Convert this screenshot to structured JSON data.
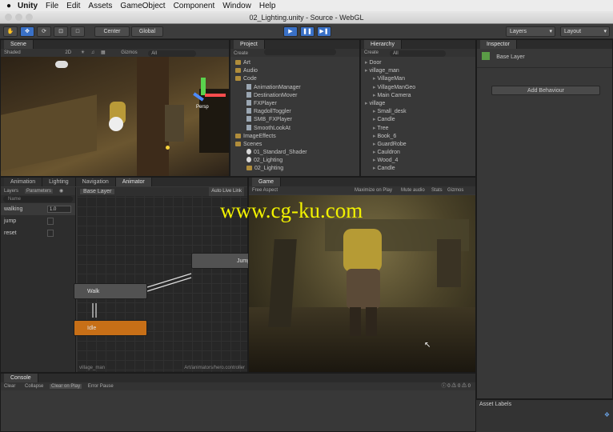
{
  "menu": {
    "app": "Unity",
    "items": [
      "File",
      "Edit",
      "Assets",
      "GameObject",
      "Component",
      "Window",
      "Help"
    ]
  },
  "window_title": "02_Lighting.unity - Source - WebGL",
  "toolbar": {
    "center": "Center",
    "global": "Global",
    "layers": "Layers",
    "layout": "Layout"
  },
  "scene": {
    "tab": "Scene",
    "shaded": "Shaded",
    "mode2d": "2D",
    "gizmos": "Gizmos",
    "search": "All",
    "persp": "Persp"
  },
  "project": {
    "tab": "Project",
    "create": "Create",
    "items": [
      {
        "label": "Art",
        "kind": "folder",
        "depth": 0
      },
      {
        "label": "Audio",
        "kind": "folder",
        "depth": 0
      },
      {
        "label": "Code",
        "kind": "folder",
        "depth": 0
      },
      {
        "label": "AnimationManager",
        "kind": "script",
        "depth": 1
      },
      {
        "label": "DestinationMover",
        "kind": "script",
        "depth": 1
      },
      {
        "label": "FXPlayer",
        "kind": "script",
        "depth": 1
      },
      {
        "label": "RagdollToggler",
        "kind": "script",
        "depth": 1
      },
      {
        "label": "SMB_FXPlayer",
        "kind": "script",
        "depth": 1
      },
      {
        "label": "SmoothLookAt",
        "kind": "script",
        "depth": 1
      },
      {
        "label": "ImageEffects",
        "kind": "folder",
        "depth": 0
      },
      {
        "label": "Scenes",
        "kind": "folder",
        "depth": 0
      },
      {
        "label": "01_Standard_Shader",
        "kind": "scene",
        "depth": 1
      },
      {
        "label": "02_Lighting",
        "kind": "scene",
        "depth": 1
      },
      {
        "label": "02_Lighting",
        "kind": "folder",
        "depth": 1
      }
    ]
  },
  "hierarchy": {
    "tab": "Hierarchy",
    "create": "Create",
    "search": "All",
    "items": [
      {
        "label": "Door",
        "depth": 0
      },
      {
        "label": "village_man",
        "depth": 0
      },
      {
        "label": "VillageMan",
        "depth": 1
      },
      {
        "label": "VillageManGeo",
        "depth": 1
      },
      {
        "label": "Main Camera",
        "depth": 1
      },
      {
        "label": "village",
        "depth": 0
      },
      {
        "label": "Small_desk",
        "depth": 1
      },
      {
        "label": "Candle",
        "depth": 1
      },
      {
        "label": "Tree",
        "depth": 1
      },
      {
        "label": "Book_6",
        "depth": 1
      },
      {
        "label": "GuardRobe",
        "depth": 1
      },
      {
        "label": "Cauldron",
        "depth": 1
      },
      {
        "label": "Wood_4",
        "depth": 1
      },
      {
        "label": "Candle",
        "depth": 1
      }
    ]
  },
  "inspector": {
    "tab": "Inspector",
    "object": "Base Layer",
    "add_behaviour": "Add Behaviour",
    "asset_labels": "Asset Labels"
  },
  "bottom_tabs": [
    "Animation",
    "Lighting",
    "Navigation",
    "Animator"
  ],
  "animator": {
    "layers_tab": "Layers",
    "params_tab": "Parameters",
    "search": "Name",
    "base_layer": "Base Layer",
    "auto_live": "Auto Live Link",
    "params": [
      {
        "name": "walking",
        "value": "1.0"
      },
      {
        "name": "jump",
        "value": ""
      },
      {
        "name": "reset",
        "value": ""
      }
    ],
    "states": {
      "walk": "Walk",
      "idle": "Idle",
      "jump": "Jump"
    },
    "footer_left": "village_man",
    "footer_right": "Art/animators/hero.controller"
  },
  "game": {
    "tab": "Game",
    "aspect": "Free Aspect",
    "maximize": "Maximize on Play",
    "mute": "Mute audio",
    "stats": "Stats",
    "gizmos": "Gizmos"
  },
  "watermark": "www.cg-ku.com",
  "console": {
    "tab": "Console",
    "buttons": [
      "Clear",
      "Collapse",
      "Clear on Play",
      "Error Pause"
    ],
    "counts": [
      "0",
      "0",
      "0"
    ]
  }
}
